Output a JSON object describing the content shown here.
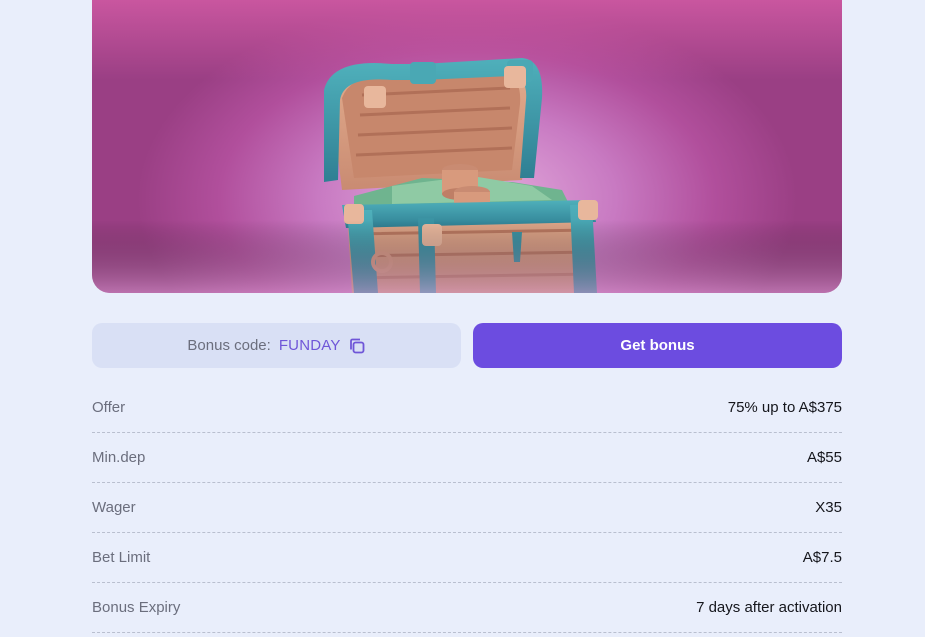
{
  "banner": {
    "image": "treasure-chest-with-coins-and-cash",
    "colors": {
      "background": "#c56fb7",
      "chest_trim": "#3f9aa8",
      "wood": "#d9a283"
    }
  },
  "bonus_code": {
    "label": "Bonus code:",
    "value": "FUNDAY",
    "icon": "copy-icon"
  },
  "get_bonus": {
    "label": "Get bonus",
    "color": "#6c4ce0"
  },
  "details": [
    {
      "key": "Offer",
      "value": "75% up to A$375"
    },
    {
      "key": "Min.dep",
      "value": "A$55"
    },
    {
      "key": "Wager",
      "value": "X35"
    },
    {
      "key": "Bet Limit",
      "value": "A$7.5"
    },
    {
      "key": "Bonus Expiry",
      "value": "7 days after activation"
    }
  ]
}
